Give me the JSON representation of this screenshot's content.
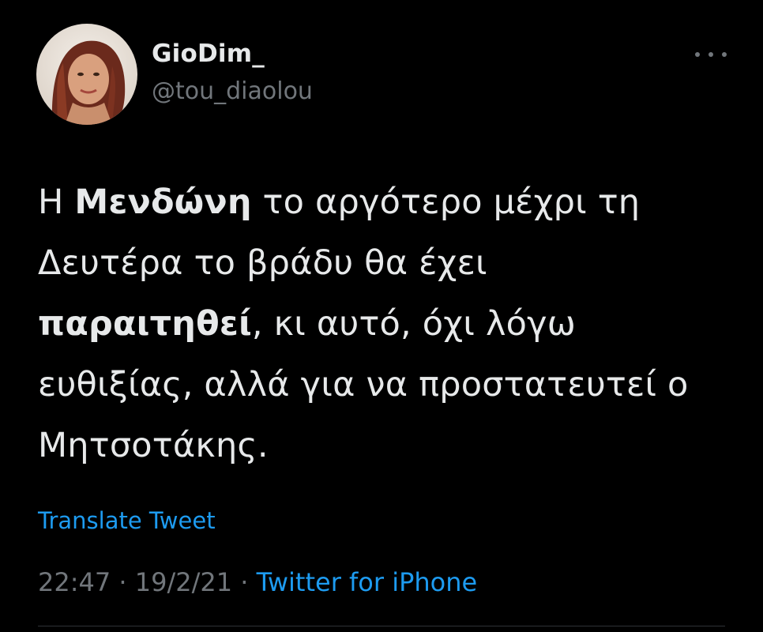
{
  "user": {
    "display_name": "GioDim_",
    "handle": "@tou_diaolou"
  },
  "tweet": {
    "lines": [
      {
        "parts": [
          {
            "text": "Η ",
            "bold": false
          },
          {
            "text": "Μενδώνη",
            "bold": true
          },
          {
            "text": " το αργότερο μέχρι τη",
            "bold": false
          }
        ]
      },
      {
        "parts": [
          {
            "text": "Δευτέρα το βράδυ θα έχει",
            "bold": false
          }
        ]
      },
      {
        "parts": [
          {
            "text": "παραιτηθεί",
            "bold": true
          },
          {
            "text": ", κι αυτό, όχι λόγω",
            "bold": false
          }
        ]
      },
      {
        "parts": [
          {
            "text": "ευθιξίας, αλλά για να προστατευτεί ο",
            "bold": false
          }
        ]
      },
      {
        "parts": [
          {
            "text": "Μητσοτάκης.",
            "bold": false
          }
        ]
      }
    ],
    "translate_label": "Translate Tweet",
    "time": "22:47",
    "separator": "·",
    "date": "19/2/21",
    "source": "Twitter for iPhone"
  },
  "icons": {
    "more": "more-options-icon",
    "avatar": "profile-avatar"
  },
  "colors": {
    "background": "#000000",
    "primary_text": "#e7e9ea",
    "secondary_text": "#71767b",
    "link": "#1d9bf0"
  }
}
